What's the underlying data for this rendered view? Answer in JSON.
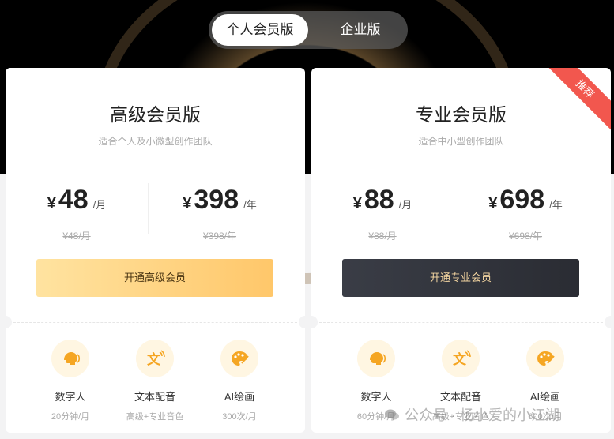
{
  "switcher": {
    "tabs": [
      "个人会员版",
      "企业版"
    ],
    "active": 0
  },
  "plans": [
    {
      "title": "高级会员版",
      "subtitle": "适合个人及小微型创作团队",
      "monthly": {
        "currency": "¥",
        "amount": "48",
        "unit": "/月",
        "original": "¥48/月"
      },
      "yearly": {
        "currency": "¥",
        "amount": "398",
        "unit": "/年",
        "original": "¥398/年"
      },
      "cta": "开通高级会员",
      "features": [
        {
          "icon": "digital-human-icon",
          "name": "数字人",
          "desc": "20分钟/月"
        },
        {
          "icon": "text-dubbing-icon",
          "name": "文本配音",
          "desc": "高级+专业音色"
        },
        {
          "icon": "ai-painting-icon",
          "name": "AI绘画",
          "desc": "300次/月"
        }
      ]
    },
    {
      "title": "专业会员版",
      "subtitle": "适合中小型创作团队",
      "badge": "推荐",
      "monthly": {
        "currency": "¥",
        "amount": "88",
        "unit": "/月",
        "original": "¥88/月"
      },
      "yearly": {
        "currency": "¥",
        "amount": "698",
        "unit": "/年",
        "original": "¥698/年"
      },
      "cta": "开通专业会员",
      "features": [
        {
          "icon": "digital-human-icon",
          "name": "数字人",
          "desc": "60分钟/月"
        },
        {
          "icon": "text-dubbing-icon",
          "name": "文本配音",
          "desc": "高级+专业音色"
        },
        {
          "icon": "ai-painting-icon",
          "name": "AI绘画",
          "desc": "600次/月"
        }
      ]
    }
  ],
  "watermark": "公众号 · 杨小爱的小江湖",
  "colors": {
    "accent_gold": "#ffc76a",
    "dark_button": "#2a2c33",
    "badge_red": "#f2574e",
    "icon_orange": "#f5a623"
  }
}
